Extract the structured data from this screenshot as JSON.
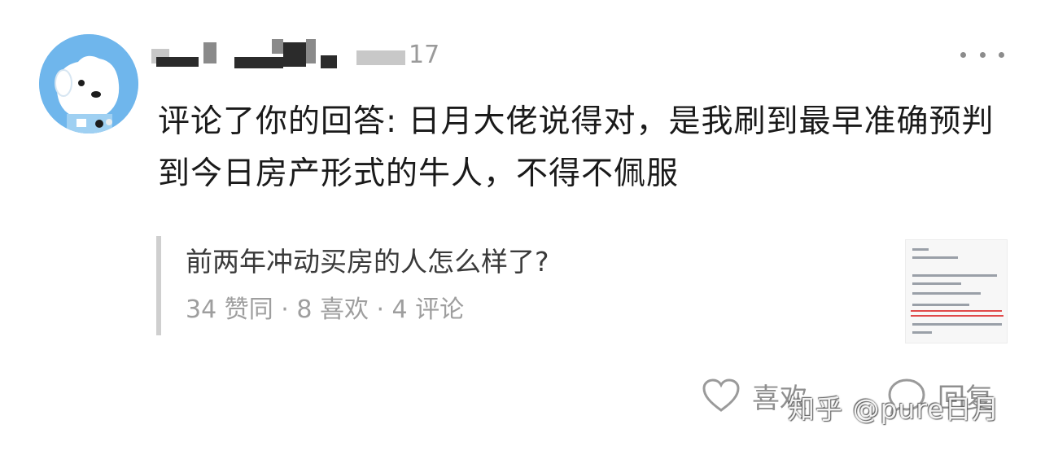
{
  "comment": {
    "user": {
      "name_obscured": true
    },
    "date": "17",
    "text": "评论了你的回答: 日月大佬说得对，是我刷到最早准确预判到今日房产形式的牛人，不得不佩服"
  },
  "quoted_answer": {
    "title": "前两年冲动买房的人怎么样了?",
    "stats": "34 赞同 · 8 喜欢 · 4 评论"
  },
  "actions": {
    "like_label": "喜欢",
    "reply_label": "回复"
  },
  "watermark": "知乎 @pure日月",
  "icons": {
    "avatar": "mascot-dog-avatar",
    "more": "more-dots-icon",
    "like": "heart-icon",
    "reply": "speech-bubble-icon"
  },
  "colors": {
    "avatar_bg": "#6fb6ec",
    "muted_text": "#9a9a9a",
    "quote_bar": "#cfcfcf"
  }
}
